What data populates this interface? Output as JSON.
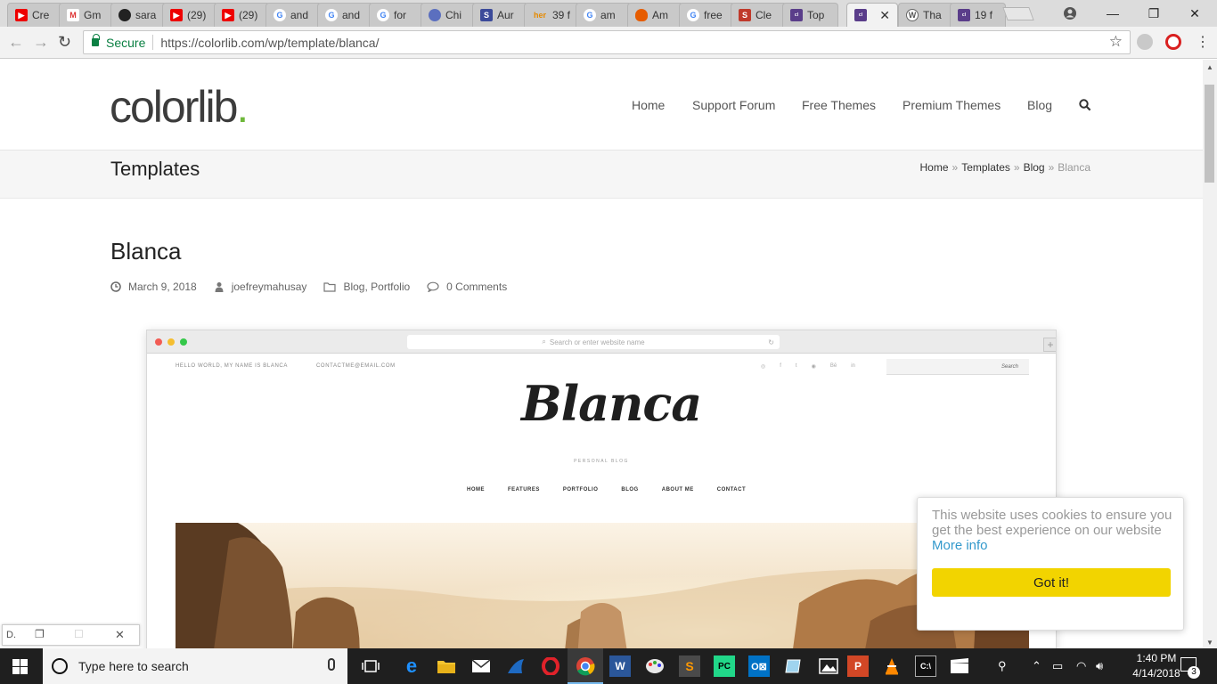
{
  "browser": {
    "tabs": [
      {
        "title": "Cre",
        "icon": "youtube-icon"
      },
      {
        "title": "Gm",
        "icon": "gmail-icon"
      },
      {
        "title": "sara",
        "icon": "github-icon"
      },
      {
        "title": "(29)",
        "icon": "youtube-icon"
      },
      {
        "title": "(29)",
        "icon": "youtube-icon"
      },
      {
        "title": "and",
        "icon": "google-icon"
      },
      {
        "title": "and",
        "icon": "google-icon"
      },
      {
        "title": "for",
        "icon": "google-icon"
      },
      {
        "title": "Chi",
        "icon": "chrome-store-icon"
      },
      {
        "title": "Aur",
        "icon": "s-icon"
      },
      {
        "title": "39 f",
        "icon": "her-icon"
      },
      {
        "title": "am",
        "icon": "google-icon"
      },
      {
        "title": "Am",
        "icon": "flame-icon"
      },
      {
        "title": "free",
        "icon": "google-icon"
      },
      {
        "title": "Cle",
        "icon": "s-red-icon"
      },
      {
        "title": "Top",
        "icon": "colorlib-icon"
      },
      {
        "title": "",
        "icon": "colorlib-icon",
        "active": true
      },
      {
        "title": "Tha",
        "icon": "wordpress-icon"
      },
      {
        "title": "19 f",
        "icon": "colorlib-icon"
      }
    ],
    "secure_label": "Secure",
    "url": "https://colorlib.com/wp/template/blanca/"
  },
  "site": {
    "logo_text": "colorlib",
    "logo_dot": ".",
    "nav": [
      "Home",
      "Support Forum",
      "Free Themes",
      "Premium Themes",
      "Blog"
    ],
    "section_title": "Templates",
    "breadcrumbs": [
      "Home",
      "Templates",
      "Blog",
      "Blanca"
    ],
    "breadcrumb_sep": "»"
  },
  "post": {
    "title": "Blanca",
    "date": "March 9, 2018",
    "author": "joefreymahusay",
    "categories": [
      "Blog",
      "Portfolio"
    ],
    "comments": "0 Comments"
  },
  "mockup": {
    "url_placeholder": "Search or enter website name",
    "top_left": "HELLO WORLD, MY NAME IS BLANCA",
    "top_email": "CONTACTME@EMAIL.COM",
    "search_label": "Search",
    "logo": "Blanca",
    "subtitle": "PERSONAL BLOG",
    "nav": [
      "HOME",
      "FEATURES",
      "PORTFOLIO",
      "BLOG",
      "ABOUT ME",
      "CONTACT"
    ]
  },
  "cookie": {
    "text": "This website uses cookies to ensure you get the best experience on our website",
    "more_link": "More info",
    "button": "Got it!"
  },
  "minimized_window": {
    "label": "D."
  },
  "taskbar": {
    "search_placeholder": "Type here to search",
    "time": "1:40 PM",
    "date": "4/14/2018",
    "notification_count": "3"
  }
}
